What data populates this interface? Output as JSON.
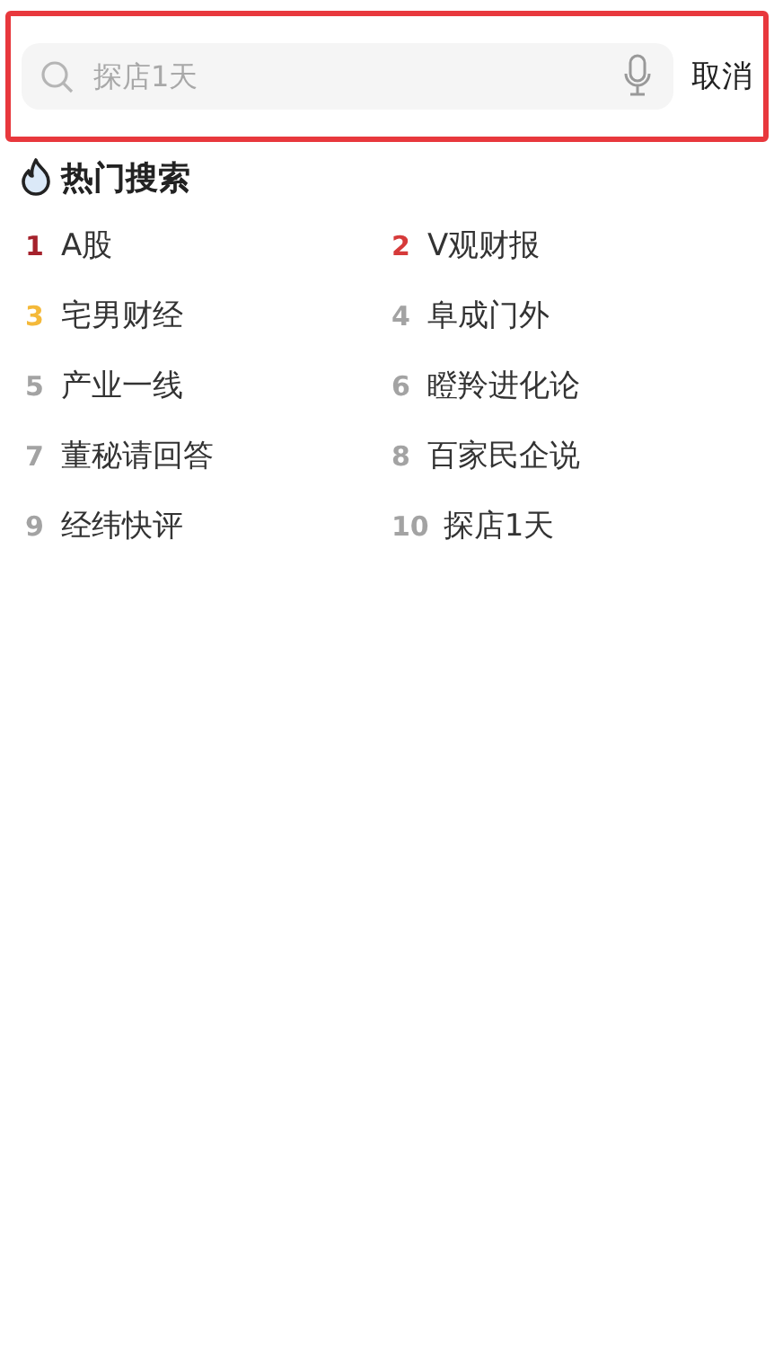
{
  "search_bar": {
    "highlighted": true,
    "placeholder": "探店1天",
    "cancel": "取消"
  },
  "hot_search": {
    "title": "热门搜索",
    "items": [
      {
        "rank": "1",
        "label": "A股",
        "color": "#a5222c"
      },
      {
        "rank": "2",
        "label": "V观财报",
        "color": "#d63a3a"
      },
      {
        "rank": "3",
        "label": "宅男财经",
        "color": "#f4b93a"
      },
      {
        "rank": "4",
        "label": "阜成门外",
        "color": "#a3a3a3"
      },
      {
        "rank": "5",
        "label": "产业一线",
        "color": "#a3a3a3"
      },
      {
        "rank": "6",
        "label": "瞪羚进化论",
        "color": "#a3a3a3"
      },
      {
        "rank": "7",
        "label": "董秘请回答",
        "color": "#a3a3a3"
      },
      {
        "rank": "8",
        "label": "百家民企说",
        "color": "#a3a3a3"
      },
      {
        "rank": "9",
        "label": "经纬快评",
        "color": "#a3a3a3"
      },
      {
        "rank": "10",
        "label": "探店1天",
        "color": "#a3a3a3"
      }
    ]
  }
}
